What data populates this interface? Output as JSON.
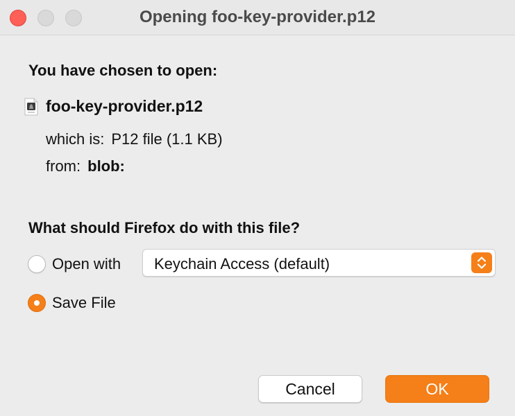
{
  "window": {
    "title": "Opening foo-key-provider.p12"
  },
  "file_section": {
    "heading": "You have chosen to open:",
    "icon": "p12-file-icon",
    "filename": "foo-key-provider.p12",
    "type_label": "which is:",
    "type_value": "P12 file (1.1 KB)",
    "from_label": "from:",
    "from_value": "blob:"
  },
  "action_section": {
    "heading": "What should Firefox do with this file?",
    "open_with": {
      "label": "Open with",
      "selected": false,
      "app_select_value": "Keychain Access (default)"
    },
    "save_file": {
      "label": "Save File",
      "selected": true
    }
  },
  "buttons": {
    "cancel": "Cancel",
    "ok": "OK"
  },
  "colors": {
    "accent": "#f57f18",
    "close_button": "#fe5f57"
  }
}
